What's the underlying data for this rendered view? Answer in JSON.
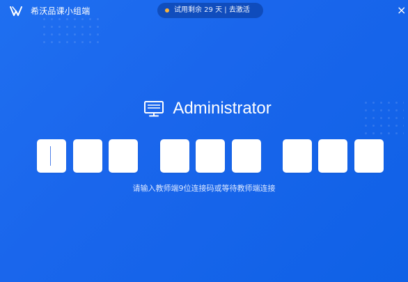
{
  "window": {
    "title": "希沃品课小组端",
    "close_glyph": "×"
  },
  "trial": {
    "text": "试用剩余 29 天 | ",
    "activate_label": "去激活"
  },
  "device": {
    "icon": "monitor-icon",
    "name": "Administrator"
  },
  "code": {
    "digits": [
      "",
      "",
      "",
      "",
      "",
      "",
      "",
      "",
      ""
    ],
    "groups": [
      3,
      3,
      3
    ],
    "active_index": 0
  },
  "hint": "请输入教师端9位连接码或等待教师端连接",
  "colors": {
    "background": "#1a66ec",
    "box": "#ffffff",
    "trial_dot": "#f8b23a"
  }
}
